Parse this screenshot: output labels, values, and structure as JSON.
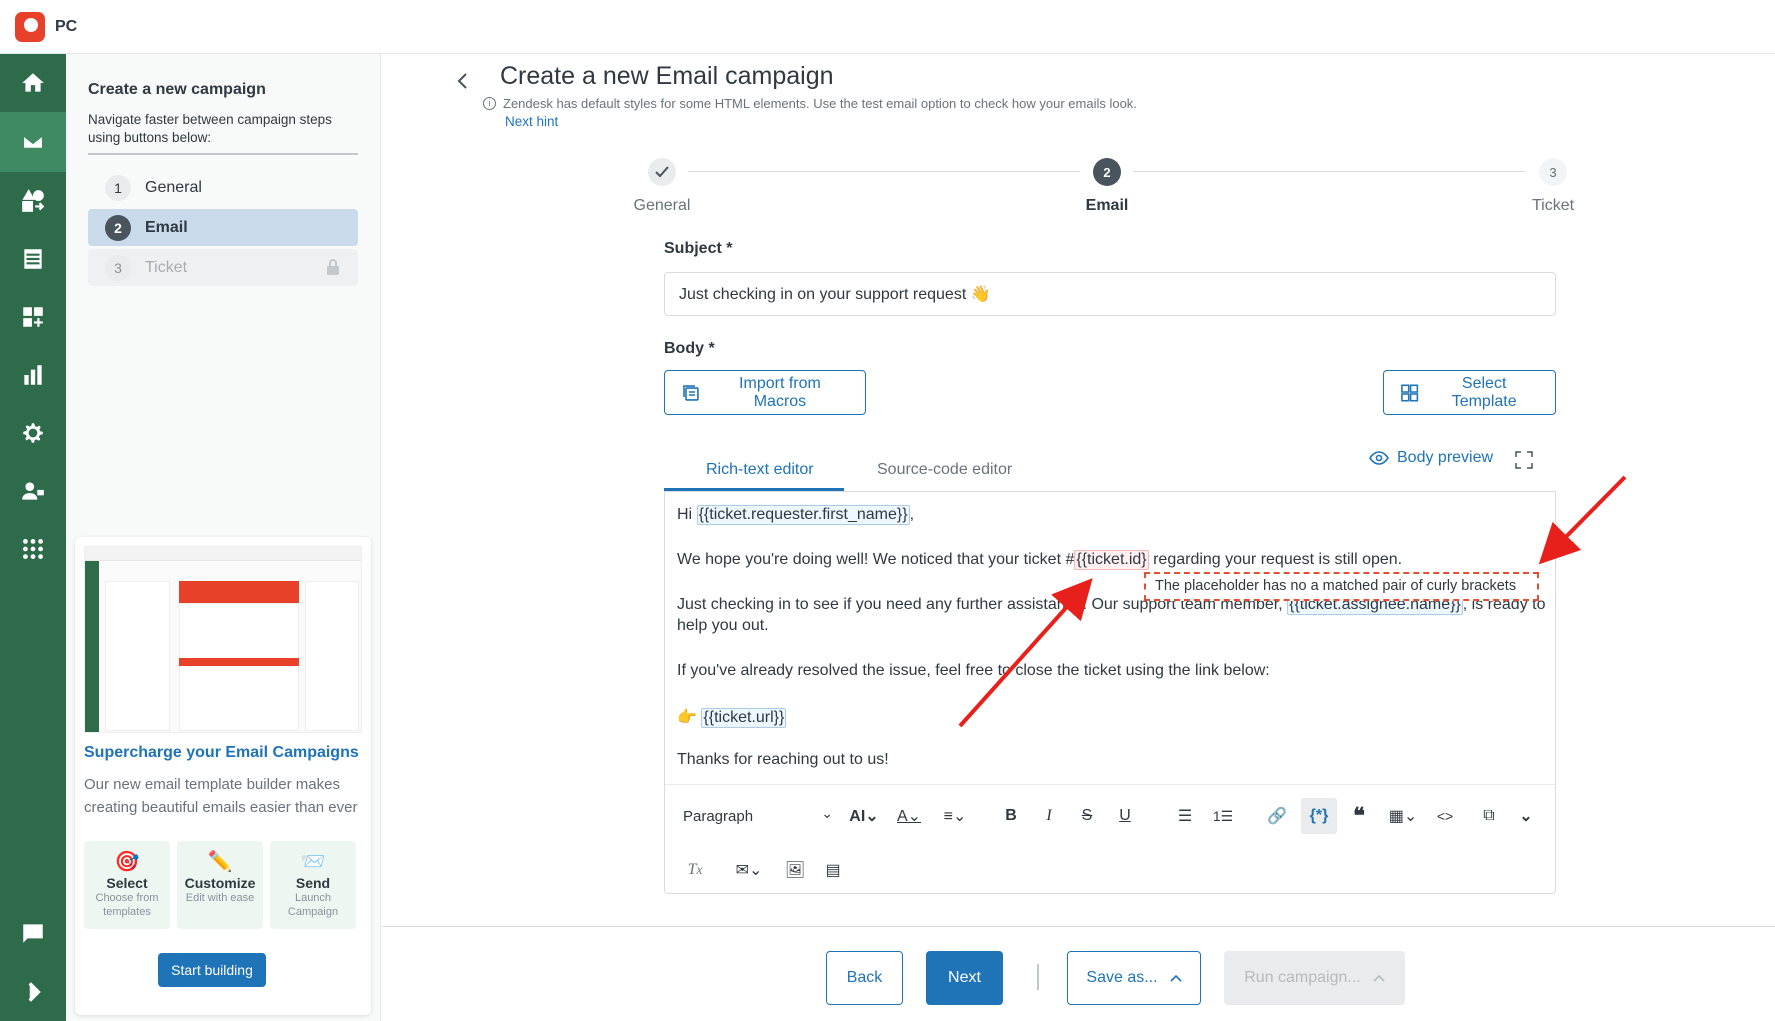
{
  "app": {
    "name": "PC"
  },
  "rail": {
    "items": [
      {
        "icon": "home-icon"
      },
      {
        "icon": "mail-icon",
        "active": true
      },
      {
        "icon": "shapes-icon"
      },
      {
        "icon": "inbox-icon"
      },
      {
        "icon": "apps-add-icon"
      },
      {
        "icon": "bar-chart-icon"
      },
      {
        "icon": "gear-icon"
      },
      {
        "icon": "user-lock-icon"
      },
      {
        "icon": "grid-icon"
      },
      {
        "icon": "chat-icon"
      },
      {
        "icon": "chevron-right-icon"
      }
    ]
  },
  "sidebar": {
    "title": "Create a new campaign",
    "description": "Navigate faster between campaign steps using buttons below:",
    "steps": [
      {
        "num": "1",
        "label": "General"
      },
      {
        "num": "2",
        "label": "Email"
      },
      {
        "num": "3",
        "label": "Ticket"
      }
    ],
    "promo": {
      "title": "Supercharge your Email Campaigns",
      "text": "Our new email template builder makes creating beautiful emails easier than ever",
      "features": [
        {
          "icon": "target-icon",
          "name": "Select",
          "desc": "Choose from templates"
        },
        {
          "icon": "pencil-icon",
          "name": "Customize",
          "desc": "Edit with ease"
        },
        {
          "icon": "send-icon",
          "name": "Send",
          "desc": "Launch Campaign"
        }
      ],
      "button": "Start building"
    }
  },
  "main": {
    "title": "Create a new Email campaign",
    "hint": "Zendesk has default styles for some HTML elements. Use the test email option to check how your emails look.",
    "next_hint": "Next hint",
    "stepper": [
      "General",
      "Email",
      "Ticket"
    ],
    "stepper_nums": [
      "2",
      "3"
    ],
    "subject_label": "Subject *",
    "subject_value": "Just checking in on your support request 👋",
    "body_label": "Body *",
    "import_macros": "Import from Macros",
    "select_template": "Select Template",
    "tabs": {
      "rich": "Rich-text editor",
      "source": "Source-code editor"
    },
    "body_preview": "Body preview",
    "editor": {
      "line1_pre": "Hi ",
      "line1_ph": "{{ticket.requester.first_name}}",
      "line1_post": ",",
      "line2_pre": "We hope you're doing well! We noticed that your ticket #",
      "line2_ph": "{{ticket.id}",
      "line2_post": " regarding your request is still open.",
      "line3_pre": "Just checking in to see if you need any further assistance. Our support team member, ",
      "line3_ph": "{{ticket.assignee.name}}",
      "line3_post": ", is ready to",
      "line4": "help you out.",
      "line5": "If you've already resolved the issue, feel free to close the ticket using the link below:",
      "line6_emoji": "👉",
      "line6_ph": "{{ticket.url}}",
      "line7": "Thanks for reaching out to us!"
    },
    "error_tooltip": "The placeholder has no a matched pair of curly brackets",
    "toolbar": {
      "paragraph": "Paragraph"
    }
  },
  "footer": {
    "back": "Back",
    "next": "Next",
    "save_as": "Save as...",
    "run_campaign": "Run campaign..."
  },
  "colors": {
    "accent": "#1f73b7",
    "rail": "#2e6b4a",
    "error": "#e34f32"
  }
}
